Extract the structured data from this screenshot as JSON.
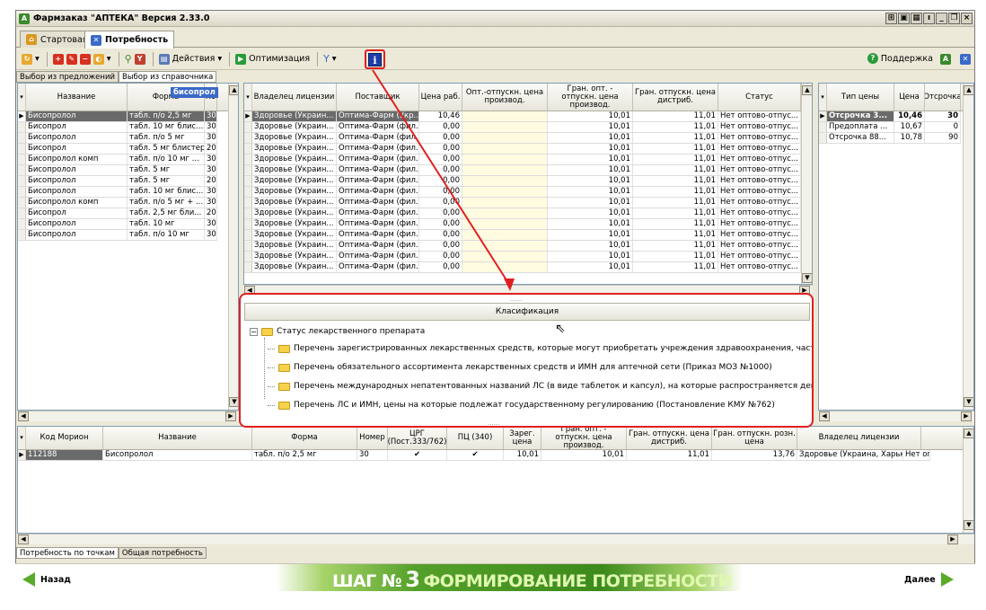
{
  "window": {
    "title": "Фармзаказ \"АПТЕКА\" Версия 2.33.0"
  },
  "tabs": [
    {
      "label": "Стартовая"
    },
    {
      "label": "Потребность"
    }
  ],
  "toolbar": {
    "actions": "Действия",
    "optimization": "Оптимизация",
    "support": "Поддержка"
  },
  "subtabs": [
    "Выбор из предложений",
    "Выбор из справочника"
  ],
  "left_grid": {
    "tooltip": "бисопрол",
    "headers": [
      "Название",
      "Форма",
      "Но"
    ],
    "rows": [
      [
        "Бисопролол",
        "табл. п/о 2,5 мг",
        "30"
      ],
      [
        "Бисопрол",
        "табл. 10 мг блис...",
        "30"
      ],
      [
        "Бисопролол",
        "табл. п/о 5 мг",
        "30"
      ],
      [
        "Бисопрол",
        "табл. 5 мг блистер",
        "20"
      ],
      [
        "Бисопролол комп",
        "табл. п/о 10 мг ...",
        "30"
      ],
      [
        "Бисопролол",
        "табл. 5 мг",
        "30"
      ],
      [
        "Бисопролол",
        "табл. 5 мг",
        "20"
      ],
      [
        "Бисопролол",
        "табл. 10 мг блис...",
        "30"
      ],
      [
        "Бисопролол комп",
        "табл. п/о 5 мг + ...",
        "30"
      ],
      [
        "Бисопрол",
        "табл. 2,5 мг бли...",
        "20"
      ],
      [
        "Бисопролол",
        "табл. 10 мг",
        "30"
      ],
      [
        "Бисопролол",
        "табл. п/о 10 мг",
        "30"
      ]
    ]
  },
  "mid_grid": {
    "headers": [
      "Владелец лицензии",
      "Поставщик",
      "Цена раб.",
      "Опт.-отпускн. цена производ.",
      "Гран. опт. - отпускн. цена производ.",
      "Гран. отпускн. цена дистриб.",
      "Статус"
    ],
    "rows": [
      [
        "Здоровье (Украин...",
        "Оптима-Фарм (Укр...",
        "10,46",
        "",
        "10,01",
        "11,01",
        "Нет оптово-отпус..."
      ],
      [
        "Здоровье (Украин...",
        "Оптима-Фарм (фил...",
        "0,00",
        "",
        "10,01",
        "11,01",
        "Нет оптово-отпус..."
      ],
      [
        "Здоровье (Украин...",
        "Оптима-Фарм (фил...",
        "0,00",
        "",
        "10,01",
        "11,01",
        "Нет оптово-отпус..."
      ],
      [
        "Здоровье (Украин...",
        "Оптима-Фарм (фил...",
        "0,00",
        "",
        "10,01",
        "11,01",
        "Нет оптово-отпус..."
      ],
      [
        "Здоровье (Украин...",
        "Оптима-Фарм (фил...",
        "0,00",
        "",
        "10,01",
        "11,01",
        "Нет оптово-отпус..."
      ],
      [
        "Здоровье (Украин...",
        "Оптима-Фарм (фил...",
        "0,00",
        "",
        "10,01",
        "11,01",
        "Нет оптово-отпус..."
      ],
      [
        "Здоровье (Украин...",
        "Оптима-Фарм (фил...",
        "0,00",
        "",
        "10,01",
        "11,01",
        "Нет оптово-отпус..."
      ],
      [
        "Здоровье (Украин...",
        "Оптима-Фарм (фил...",
        "0,00",
        "",
        "10,01",
        "11,01",
        "Нет оптово-отпус..."
      ],
      [
        "Здоровье (Украин...",
        "Оптима-Фарм (фил...",
        "0,00",
        "",
        "10,01",
        "11,01",
        "Нет оптово-отпус..."
      ],
      [
        "Здоровье (Украин...",
        "Оптима-Фарм (фил...",
        "0,00",
        "",
        "10,01",
        "11,01",
        "Нет оптово-отпус..."
      ],
      [
        "Здоровье (Украин...",
        "Оптима-Фарм (фил...",
        "0,00",
        "",
        "10,01",
        "11,01",
        "Нет оптово-отпус..."
      ],
      [
        "Здоровье (Украин...",
        "Оптима-Фарм (фил...",
        "0,00",
        "",
        "10,01",
        "11,01",
        "Нет оптово-отпус..."
      ],
      [
        "Здоровье (Украин...",
        "Оптима-Фарм (фил...",
        "0,00",
        "",
        "10,01",
        "11,01",
        "Нет оптово-отпус..."
      ],
      [
        "Здоровье (Украин...",
        "Оптима-Фарм (фил...",
        "0,00",
        "",
        "10,01",
        "11,01",
        "Нет оптово-отпус..."
      ],
      [
        "Здоровье (Украин...",
        "Оптима-Фарм (фил...",
        "0,00",
        "",
        "10,01",
        "11,01",
        "Нет оптово-отпус..."
      ]
    ]
  },
  "right_grid": {
    "headers": [
      "Тип цены",
      "Цена",
      "Отсрочка"
    ],
    "rows": [
      [
        "Отсрочка 3...",
        "10,46",
        "30"
      ],
      [
        "Предоплата ...",
        "10,67",
        "0"
      ],
      [
        "Отсрочка 88...",
        "10,78",
        "90"
      ]
    ]
  },
  "classification": {
    "header": "Класификация",
    "root": "Статус лекарственного препарата",
    "items": [
      "Перечень зарегистрированных лекарственных средств, которые могут приобретать  учреждения здравоохранения, частично или ...",
      "Перечень обязательного ассортимента лекарственных средств и ИМН для аптечной сети (Приказ МОЗ №1000)",
      "  Перечень международных непатентованных названий ЛС (в виде таблеток и капсул), на которые распространяется действие пи...",
      "Перечень ЛС и ИМН, цены на которые подлежат государственному регулированию (Постановление КМУ №762)"
    ]
  },
  "bottom_grid": {
    "headers": [
      "Код Морион",
      "Название",
      "Форма",
      "Номер",
      "ЦРГ (Пост.333/762)",
      "ПЦ (340)",
      "Зарег. цена",
      "Гран. опт. - отпускн. цена производ.",
      "Гран. отпускн. цена дистриб.",
      "Гран. отпускн. розн. цена",
      "Владелец лицензии"
    ],
    "row": [
      "112188",
      "Бисопролол",
      "табл. п/о 2,5 мг",
      "30",
      "✔",
      "✔",
      "10,01",
      "10,01",
      "11,01",
      "13,76",
      "Здоровье (Украина, Харьк...",
      "Нет оп"
    ]
  },
  "bottom_tabs": [
    "Потребность по точкам",
    "Общая потребность"
  ],
  "nav": {
    "back": "Назад",
    "next": "Далее",
    "step_prefix": "ШАГ №",
    "step_num": "3",
    "step_title": "ФОРМИРОВАНИЕ ПОТРЕБНОСТИ"
  }
}
